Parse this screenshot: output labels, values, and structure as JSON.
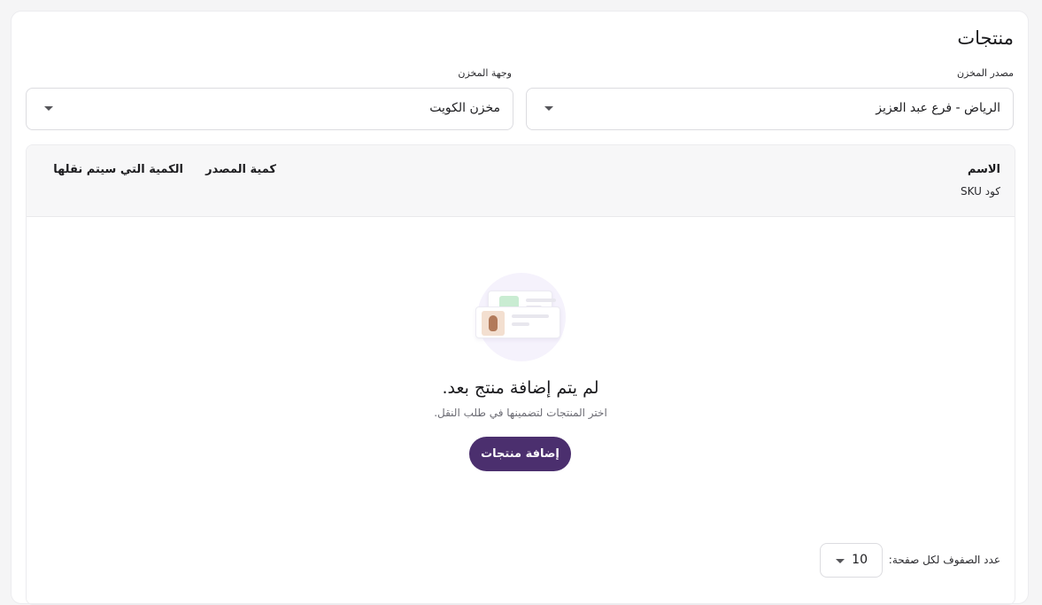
{
  "page": {
    "title": "منتجات"
  },
  "form": {
    "source": {
      "label": "مصدر المخزن",
      "value": "الرياض - فرع عبد العزيز"
    },
    "destination": {
      "label": "وجهة المخزن",
      "value": "مخزن الكويت"
    }
  },
  "table": {
    "columns": {
      "name": "الاسم",
      "sku": "كود SKU",
      "source_qty": "كمية المصدر",
      "transfer_qty": "الكمية التي سيتم نقلها"
    },
    "empty": {
      "title": "لم يتم إضافة منتج بعد.",
      "subtitle": "اختر المنتجات لتضمينها في طلب النقل.",
      "button_label": "إضافة منتجات"
    }
  },
  "pagination": {
    "rows_label": "عدد الصفوف لكل صفحة:",
    "rows_value": "10"
  },
  "colors": {
    "accent": "#4b2f6e",
    "page_bg": "#f5f5f6"
  },
  "icons": {
    "select_caret": "caret-down-icon",
    "empty_state": "products-illustration"
  }
}
